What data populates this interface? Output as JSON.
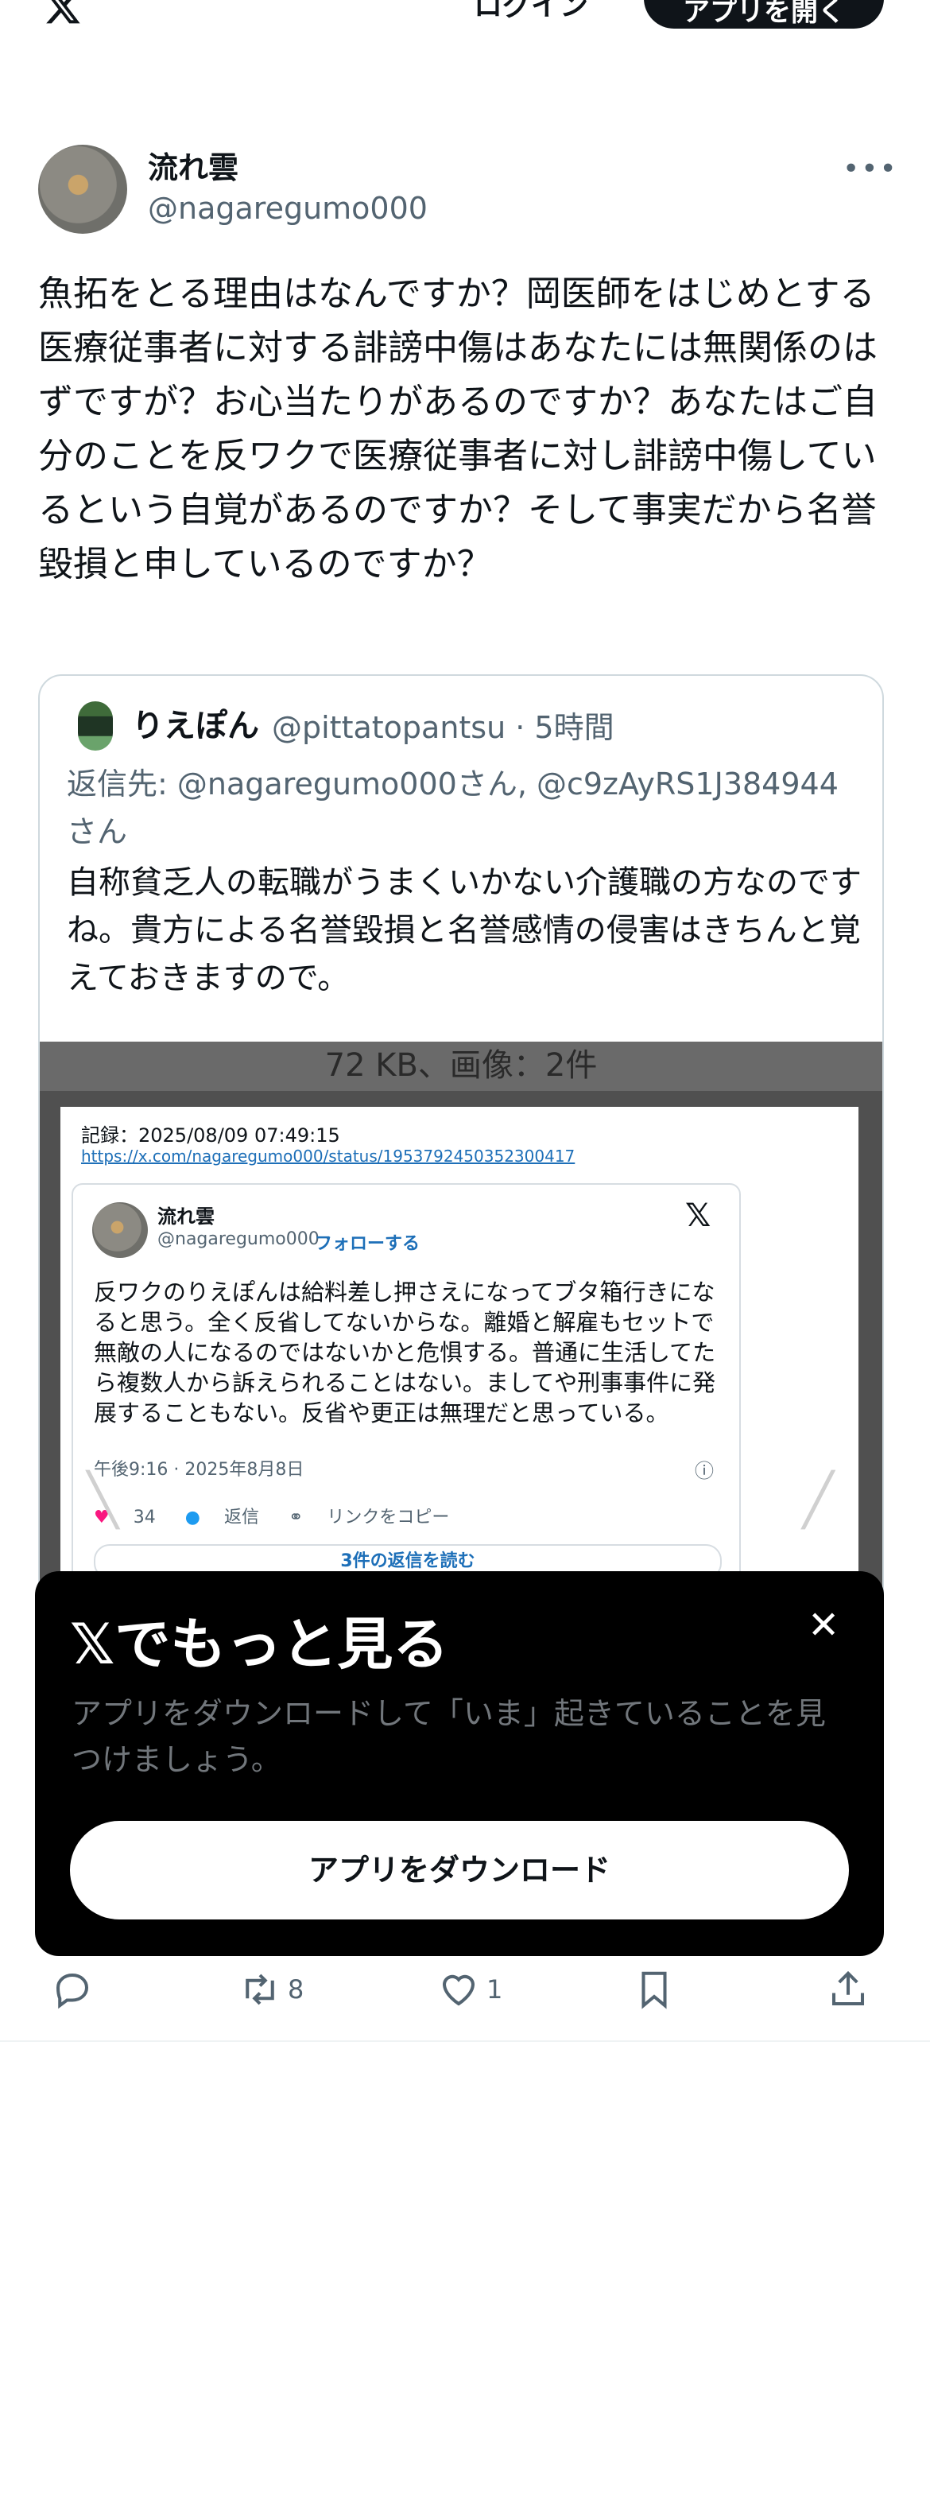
{
  "header": {
    "login_label": "ログイン",
    "open_app_label": "アプリを開く",
    "logo_icon": "x-logo-icon"
  },
  "tweet": {
    "author_name": "流れ雲",
    "author_handle": "@nagaregumo000",
    "more_label": "•••",
    "text": "魚拓をとる理由はなんですか？岡医師をはじめとする医療従事者に対する誹謗中傷はあなたには無関係のはずですが？お心当たりがあるのですか？あなたはご自分のことを反ワクで医療従事者に対し誹謗中傷しているという自覚があるのですか？そして事実だから名誉毀損と申しているのですか？",
    "stats": {
      "retweets": "8",
      "likes": "1"
    }
  },
  "quote": {
    "author_name": "りえぽん",
    "author_handle": "@pittatopantsu · 5時間",
    "reply_to": "返信先: @nagaregumo000さん, @c9zAyRS1J384944さん",
    "text": "自称貧乏人の転職がうまくいかない介護職の方なのですね。貴方による名誉毀損と名誉感情の侵害はきちんと覚えておきますので。",
    "media": {
      "top_label": "72 KB、画像：2件",
      "record": "記録：2025/08/09 07:49:15",
      "url": "https://x.com/nagaregumo000/status/1953792450352300417",
      "card": {
        "name": "流れ雲",
        "handle": "@nagaregumo000 ·",
        "follow": "フォローする",
        "text": "反ワクのりえぽんは給料差し押さえになってブタ箱行きになると思う。全く反省してないからな。離婚と解雇もセットで無敵の人になるのではないかと危惧する。普通に生活してたら複数人から訴えられることはない。ましてや刑事事件に発展することもない。反省や更正は無理だと思っている。",
        "time": "午後9:16 · 2025年8月8日",
        "likes": "34",
        "reply": "返信",
        "copy_link": "リンクをコピー",
        "read_replies": "3件の返信を読む"
      }
    }
  },
  "signup_panel": {
    "title": "𝕏でもっと見る",
    "subtitle": "アプリをダウンロードして「いま」起きていることを見つけましょう。",
    "button": "アプリをダウンロード",
    "close": "✕"
  }
}
